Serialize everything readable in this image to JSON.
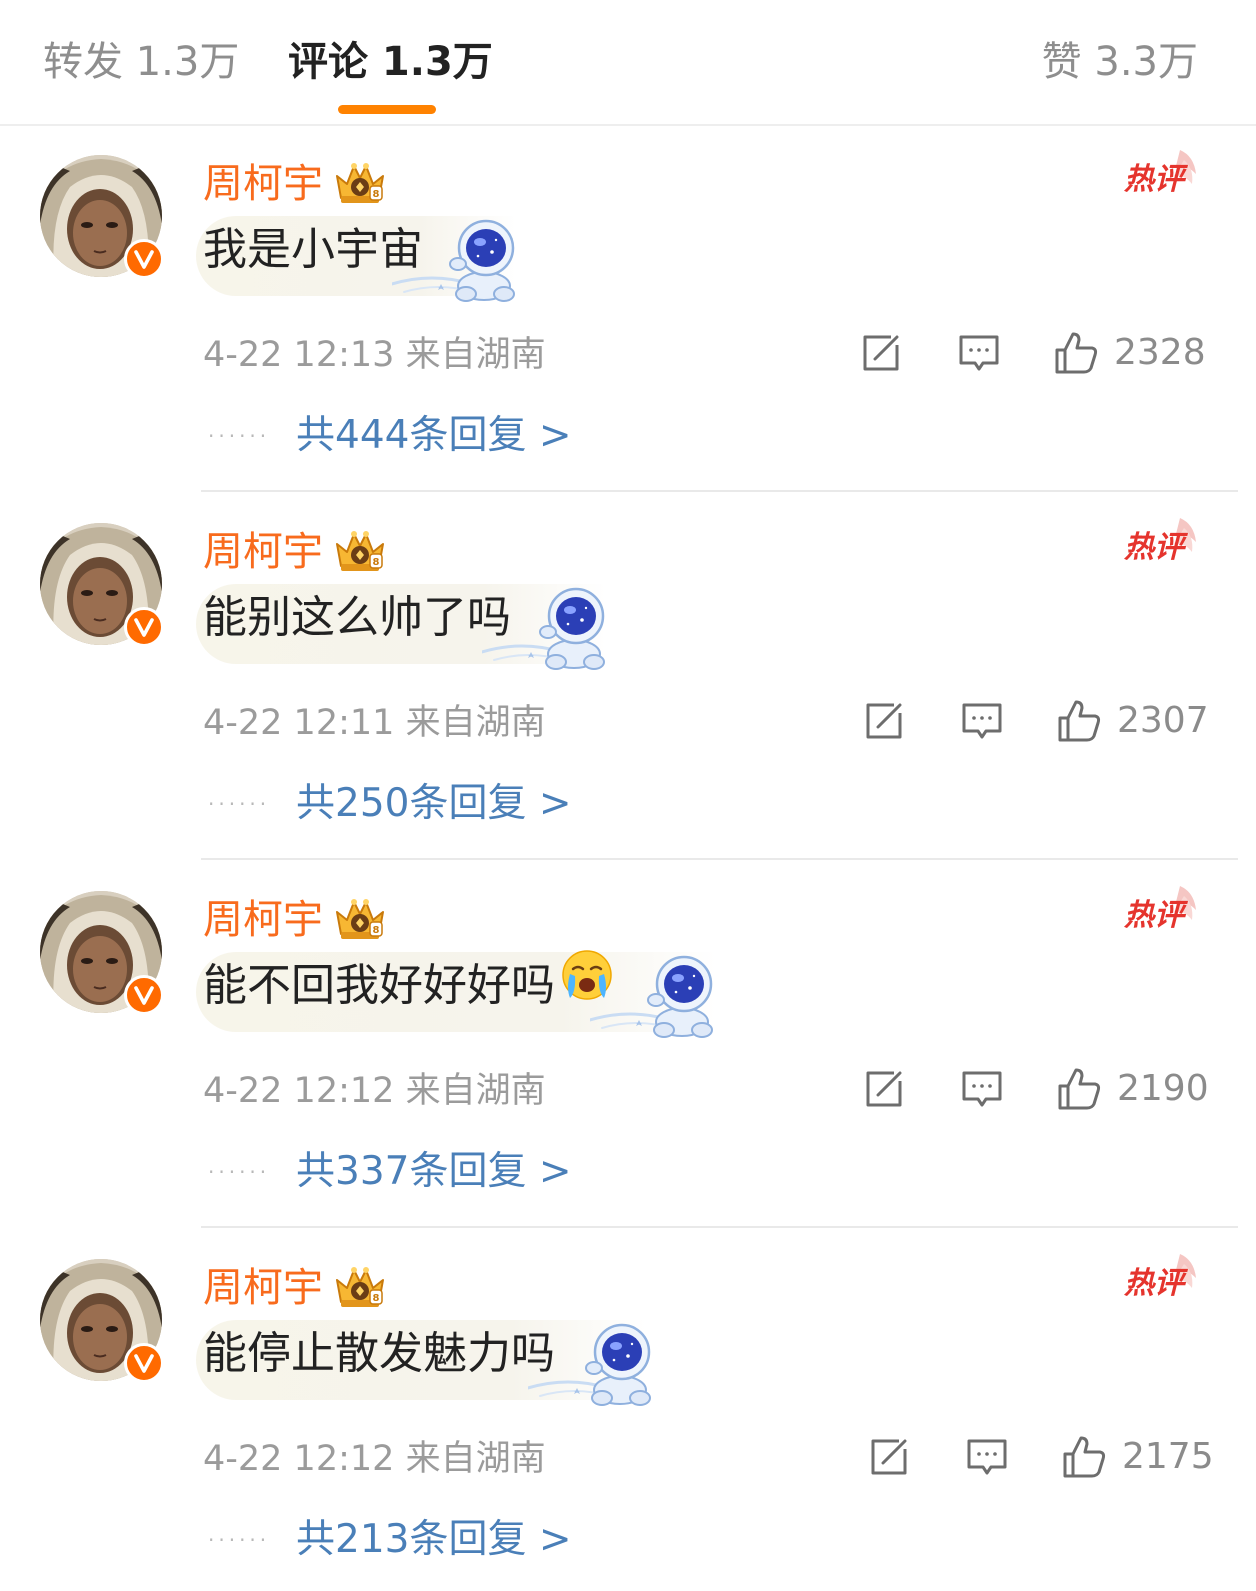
{
  "tabs": {
    "reposts": "转发 1.3万",
    "comments": "评论 1.3万",
    "likes": "赞 3.3万",
    "active": "comments"
  },
  "colors": {
    "accent": "#ff8200",
    "username": "#f86b1d",
    "link": "#4a7fb8",
    "hot_tag": "#e5342d"
  },
  "icons": {
    "tab_indicator": "orange-underline",
    "crown": "crown-badge-icon",
    "verified": "verified-v-icon",
    "hot": "hot-comment-tag",
    "decoration": "astronaut-sticker-icon",
    "share": "share-icon",
    "reply": "comment-bubble-icon",
    "like": "thumbs-up-icon"
  },
  "hot_tag_text": "热评",
  "comments": [
    {
      "username": "周柯宇",
      "text": "我是小宇宙",
      "time": "4-22 12:13",
      "location": "来自湖南",
      "likes": "2328",
      "replies": "共444条回复 >"
    },
    {
      "username": "周柯宇",
      "text": "能别这么帅了吗",
      "time": "4-22 12:11",
      "location": "来自湖南",
      "likes": "2307",
      "replies": "共250条回复 >"
    },
    {
      "username": "周柯宇",
      "text": "能不回我好好好吗",
      "emoji": "loudly-crying-face",
      "time": "4-22 12:12",
      "location": "来自湖南",
      "likes": "2190",
      "replies": "共337条回复 >"
    },
    {
      "username": "周柯宇",
      "text": "能停止散发魅力吗",
      "time": "4-22 12:12",
      "location": "来自湖南",
      "likes": "2175",
      "replies": "共213条回复 >"
    }
  ]
}
